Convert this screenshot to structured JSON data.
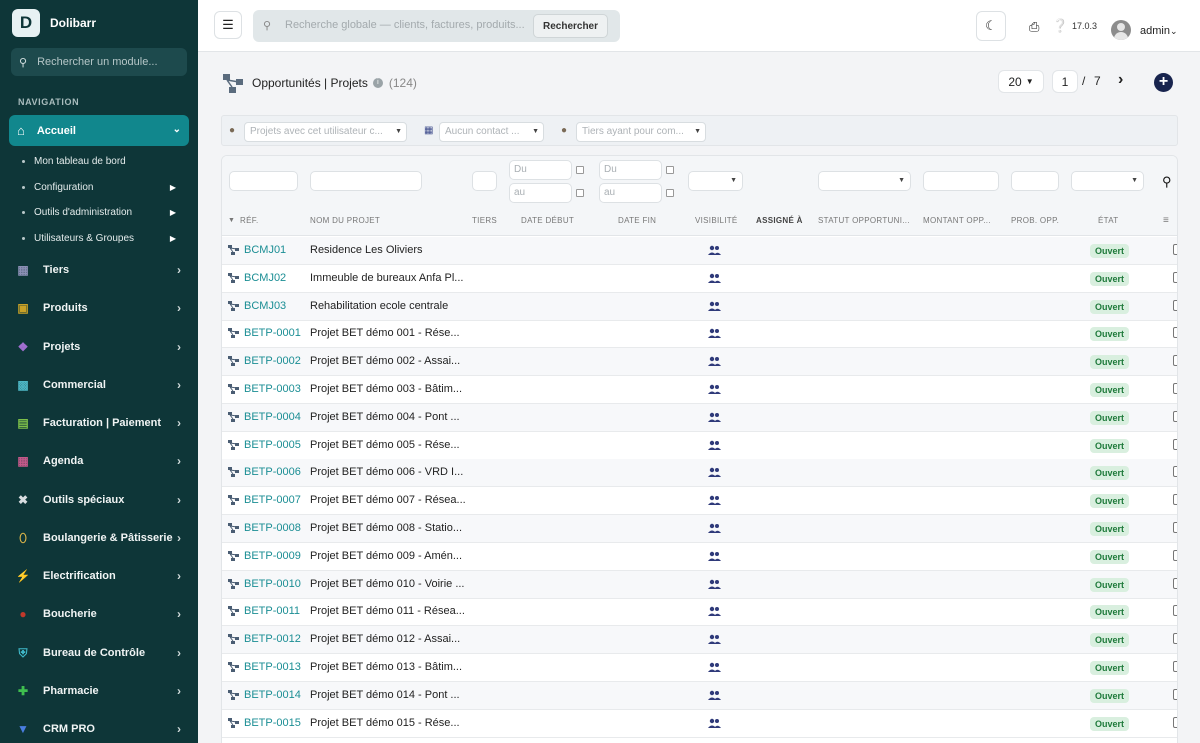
{
  "app": {
    "name": "Dolibarr",
    "logo_letter": "D"
  },
  "sidebar": {
    "search_placeholder": "Rechercher un module...",
    "section_label": "NAVIGATION",
    "active": {
      "label": "Accueil",
      "icon": "home-icon"
    },
    "subitems": [
      {
        "label": "Mon tableau de bord",
        "has_arrow": false
      },
      {
        "label": "Configuration",
        "has_arrow": true
      },
      {
        "label": "Outils d'administration",
        "has_arrow": true
      },
      {
        "label": "Utilisateurs & Groupes",
        "has_arrow": true
      }
    ],
    "items": [
      {
        "label": "Tiers",
        "icon": "building-icon",
        "color": "#8b8fb5"
      },
      {
        "label": "Produits",
        "icon": "cube-icon",
        "color": "#c9a227"
      },
      {
        "label": "Projets",
        "icon": "project-icon",
        "color": "#a06fd0"
      },
      {
        "label": "Commercial",
        "icon": "briefcase-icon",
        "color": "#4db6c4"
      },
      {
        "label": "Facturation | Paiement",
        "icon": "invoice-icon",
        "color": "#7dbf4a"
      },
      {
        "label": "Agenda",
        "icon": "calendar-icon",
        "color": "#c5598a"
      },
      {
        "label": "Outils spéciaux",
        "icon": "tools-icon",
        "color": "#d8dde0"
      },
      {
        "label": "Boulangerie & Pâtisserie",
        "icon": "bread-icon",
        "color": "#e0b84a"
      },
      {
        "label": "Electrification",
        "icon": "bolt-icon",
        "color": "#f2c318"
      },
      {
        "label": "Boucherie",
        "icon": "meat-icon",
        "color": "#c0392b"
      },
      {
        "label": "Bureau de Contrôle",
        "icon": "shield-icon",
        "color": "#3fb8c8"
      },
      {
        "label": "Pharmacie",
        "icon": "plus-icon",
        "color": "#3fbf4f"
      },
      {
        "label": "CRM PRO",
        "icon": "funnel-icon",
        "color": "#4a7ee0"
      }
    ]
  },
  "topbar": {
    "search_placeholder": "Recherche globale — clients, factures, produits...",
    "search_button": "Rechercher",
    "version": "17.0.3",
    "user": "admin"
  },
  "page": {
    "title": "Opportunités | Projets",
    "count": "(124)",
    "per_page": "20",
    "current_page": "1",
    "page_separator": "/",
    "total_pages": "7"
  },
  "filters": {
    "user_projects": "Projets avec cet utilisateur c...",
    "contact": "Aucun contact ...",
    "thirdparty": "Tiers ayant pour com..."
  },
  "date_filters": {
    "from": "Du",
    "to": "au"
  },
  "columns": [
    "RÉF.",
    "NOM DU PROJET",
    "TIERS",
    "DATE DÉBUT",
    "DATE FIN",
    "VISIBILITÉ",
    "ASSIGNÉ À",
    "STATUT OPPORTUNI...",
    "MONTANT OPP...",
    "PROB. OPP.",
    "ÉTAT"
  ],
  "rows": [
    {
      "ref": "BCMJ01",
      "name": "Residence Les Oliviers",
      "status": "Ouvert"
    },
    {
      "ref": "BCMJ02",
      "name": "Immeuble de bureaux Anfa Pl...",
      "status": "Ouvert"
    },
    {
      "ref": "BCMJ03",
      "name": "Rehabilitation ecole centrale",
      "status": "Ouvert"
    },
    {
      "ref": "BETP-0001",
      "name": "Projet BET démo 001 - Rése...",
      "status": "Ouvert"
    },
    {
      "ref": "BETP-0002",
      "name": "Projet BET démo 002 - Assai...",
      "status": "Ouvert"
    },
    {
      "ref": "BETP-0003",
      "name": "Projet BET démo 003 - Bâtim...",
      "status": "Ouvert"
    },
    {
      "ref": "BETP-0004",
      "name": "Projet BET démo 004 - Pont ...",
      "status": "Ouvert"
    },
    {
      "ref": "BETP-0005",
      "name": "Projet BET démo 005 - Rése...",
      "status": "Ouvert"
    },
    {
      "ref": "BETP-0006",
      "name": "Projet BET démo 006 - VRD I...",
      "status": "Ouvert"
    },
    {
      "ref": "BETP-0007",
      "name": "Projet BET démo 007 - Résea...",
      "status": "Ouvert"
    },
    {
      "ref": "BETP-0008",
      "name": "Projet BET démo 008 - Statio...",
      "status": "Ouvert"
    },
    {
      "ref": "BETP-0009",
      "name": "Projet BET démo 009 - Amén...",
      "status": "Ouvert"
    },
    {
      "ref": "BETP-0010",
      "name": "Projet BET démo 010 - Voirie ...",
      "status": "Ouvert"
    },
    {
      "ref": "BETP-0011",
      "name": "Projet BET démo 011 - Résea...",
      "status": "Ouvert"
    },
    {
      "ref": "BETP-0012",
      "name": "Projet BET démo 012 - Assai...",
      "status": "Ouvert"
    },
    {
      "ref": "BETP-0013",
      "name": "Projet BET démo 013 - Bâtim...",
      "status": "Ouvert"
    },
    {
      "ref": "BETP-0014",
      "name": "Projet BET démo 014 - Pont ...",
      "status": "Ouvert"
    },
    {
      "ref": "BETP-0015",
      "name": "Projet BET démo 015 - Rése...",
      "status": "Ouvert"
    }
  ]
}
